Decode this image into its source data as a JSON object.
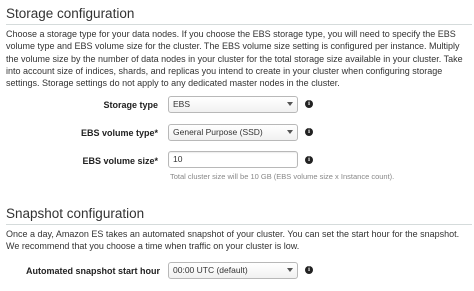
{
  "storage": {
    "title": "Storage configuration",
    "description": "Choose a storage type for your data nodes. If you choose the EBS storage type, you will need to specify the EBS volume type and EBS volume size for the cluster. The EBS volume size setting is configured per instance. Multiply the volume size by the number of data nodes in your cluster for the total storage size available in your cluster. Take into account size of indices, shards, and replicas you intend to create in your cluster when configuring storage settings. Storage settings do not apply to any dedicated master nodes in the cluster.",
    "storage_type": {
      "label": "Storage type",
      "value": "EBS"
    },
    "volume_type": {
      "label": "EBS volume type*",
      "value": "General Purpose (SSD)"
    },
    "volume_size": {
      "label": "EBS volume size*",
      "value": "10",
      "hint": "Total cluster size will be 10 GB (EBS volume size x Instance count)."
    }
  },
  "snapshot": {
    "title": "Snapshot configuration",
    "description": "Once a day, Amazon ES takes an automated snapshot of your cluster. You can set the start hour for the snapshot. We recommend that you choose a time when traffic on your cluster is low.",
    "start_hour": {
      "label": "Automated snapshot start hour",
      "value": "00:00 UTC (default)"
    }
  },
  "icons": {
    "info": "info-icon",
    "dropdown": "chevron-down-icon"
  },
  "colors": {
    "divider": "#d5dbdb",
    "label": "#222222",
    "hint": "#888888"
  }
}
